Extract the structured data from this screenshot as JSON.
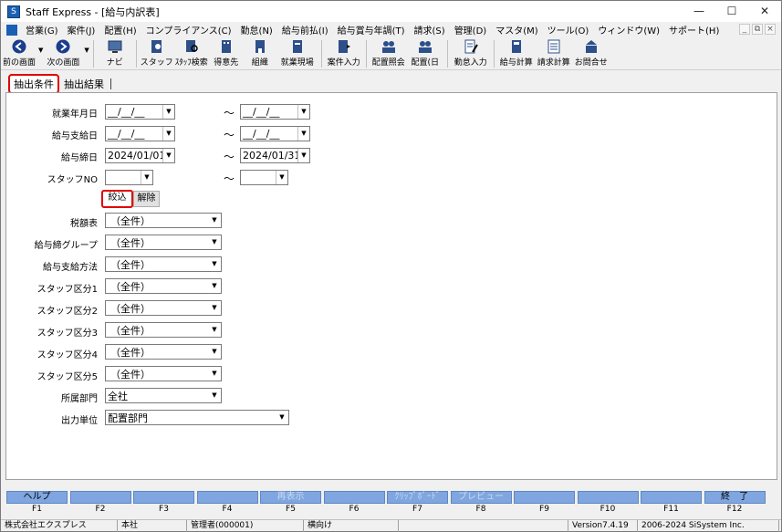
{
  "window": {
    "title": "Staff Express - [給与内訳表]",
    "app_icon_glyph": "S",
    "minimize": "—",
    "maximize": "☐",
    "close": "✕"
  },
  "menu": {
    "items": [
      "営業(G)",
      "案件(J)",
      "配置(H)",
      "コンプライアンス(C)",
      "勤怠(N)",
      "給与前払(I)",
      "給与賞与年調(T)",
      "請求(S)",
      "管理(D)",
      "マスタ(M)",
      "ツール(O)",
      "ウィンドウ(W)",
      "サポート(H)"
    ],
    "mdi_min": "_",
    "mdi_restore": "⧉",
    "mdi_close": "×"
  },
  "toolbar": {
    "back": "前の画面",
    "forward": "次の画面",
    "navi": "ナビ",
    "staff": "スタッフ",
    "staff_search": "ｽﾀｯﾌ検索",
    "client": "得意先",
    "org": "組織",
    "site": "就業現場",
    "case_input": "案件入力",
    "assign_view": "配置照会",
    "assign_day": "配置(日",
    "attendance": "勤怠入力",
    "payroll_calc": "給与計算",
    "billing_calc": "請求計算",
    "inquiry": "お問合せ"
  },
  "tabs": {
    "conditions": "抽出条件",
    "results": "抽出結果"
  },
  "form": {
    "work_date": {
      "label": "就業年月日",
      "from": "__/__/__",
      "to": "__/__/__"
    },
    "pay_date": {
      "label": "給与支給日",
      "from": "__/__/__",
      "to": "__/__/__"
    },
    "close_date": {
      "label": "給与締日",
      "from": "2024/01/01",
      "to": "2024/01/31"
    },
    "staff_no": {
      "label": "スタッフNO",
      "from": "",
      "to": ""
    },
    "tilde": "～",
    "filter_button": "絞込",
    "clear_button": "解除",
    "tax_table": {
      "label": "税額表",
      "value": "（全件）"
    },
    "close_group": {
      "label": "給与締グループ",
      "value": "（全件）"
    },
    "pay_method": {
      "label": "給与支給方法",
      "value": "（全件）"
    },
    "staff_cat1": {
      "label": "スタッフ区分1",
      "value": "（全件）"
    },
    "staff_cat2": {
      "label": "スタッフ区分2",
      "value": "（全件）"
    },
    "staff_cat3": {
      "label": "スタッフ区分3",
      "value": "（全件）"
    },
    "staff_cat4": {
      "label": "スタッフ区分4",
      "value": "（全件）"
    },
    "staff_cat5": {
      "label": "スタッフ区分5",
      "value": "（全件）"
    },
    "department": {
      "label": "所属部門",
      "value": "全社"
    },
    "output_unit": {
      "label": "出力単位",
      "value": "配置部門"
    }
  },
  "fkeys": [
    {
      "label": "ヘルプ",
      "code": "F1",
      "enabled": true
    },
    {
      "label": "",
      "code": "F2",
      "enabled": true
    },
    {
      "label": "",
      "code": "F3",
      "enabled": true
    },
    {
      "label": "",
      "code": "F4",
      "enabled": true
    },
    {
      "label": "再表示",
      "code": "F5",
      "enabled": false
    },
    {
      "label": "",
      "code": "F6",
      "enabled": true
    },
    {
      "label": "ｸﾘｯﾌﾟﾎﾞｰﾄﾞ",
      "code": "F7",
      "enabled": false
    },
    {
      "label": "プレビュー",
      "code": "F8",
      "enabled": false
    },
    {
      "label": "",
      "code": "F9",
      "enabled": true
    },
    {
      "label": "",
      "code": "F10",
      "enabled": true
    },
    {
      "label": "",
      "code": "F11",
      "enabled": true
    },
    {
      "label": "終　了",
      "code": "F12",
      "enabled": true
    }
  ],
  "status": {
    "company": "株式会社エクスプレス",
    "branch": "本社",
    "user": "管理者(000001)",
    "audience": "横向け",
    "blank": "",
    "version": "Version7.4.19",
    "copyright": "2006-2024 SiSystem Inc."
  },
  "colors": {
    "fkey_bg": "#7fa6e0",
    "highlight_border": "#e00000",
    "accent_blue": "#1a5fb4"
  }
}
